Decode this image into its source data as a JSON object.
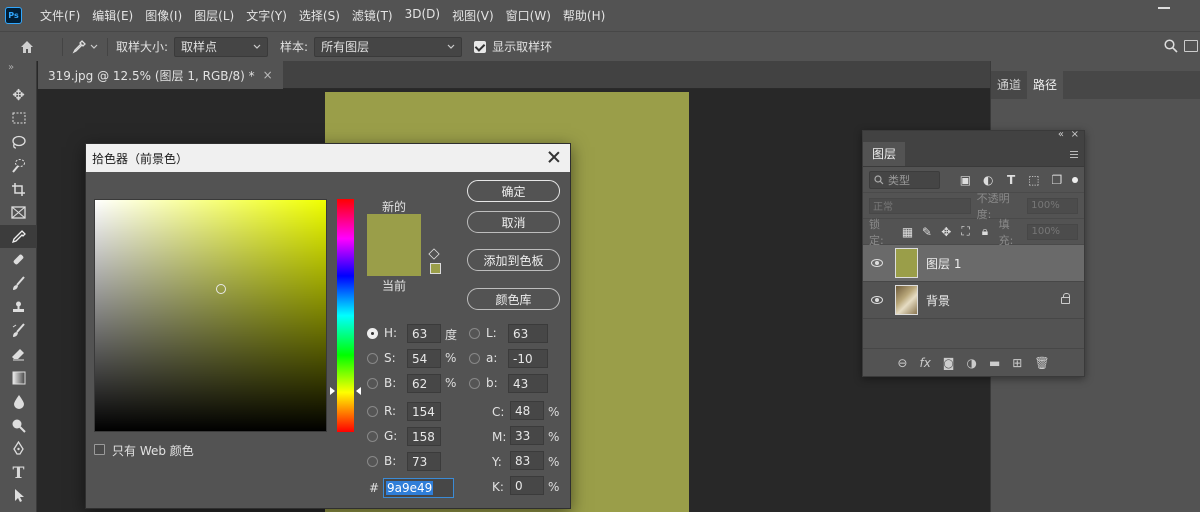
{
  "app": {
    "logo": "Ps"
  },
  "menu": [
    "文件(F)",
    "编辑(E)",
    "图像(I)",
    "图层(L)",
    "文字(Y)",
    "选择(S)",
    "滤镜(T)",
    "3D(D)",
    "视图(V)",
    "窗口(W)",
    "帮助(H)"
  ],
  "options": {
    "sample_size_label": "取样大小:",
    "sample_size_value": "取样点",
    "sample_label": "样本:",
    "sample_value": "所有图层",
    "show_ring_label": "显示取样环"
  },
  "document": {
    "tab_title": "319.jpg @ 12.5% (图层 1, RGB/8) *",
    "tab_close": "×",
    "fill_color": "#9a9e49"
  },
  "dock": {
    "tabs": [
      "通道",
      "路径"
    ]
  },
  "layers_panel": {
    "collapse": "«",
    "close": "×",
    "tab": "图层",
    "filter_placeholder": "类型",
    "blend_mode": "正常",
    "opacity_label": "不透明度:",
    "opacity_value": "100%",
    "lock_label": "锁定:",
    "fill_label": "填充:",
    "fill_value": "100%",
    "layers": [
      {
        "name": "图层 1",
        "thumb_color": "#9a9e49",
        "selected": true
      },
      {
        "name": "背景",
        "thumb_color": "#b9a77a",
        "locked": true
      }
    ],
    "footer_icons": [
      "link-icon",
      "fx-icon",
      "mask-icon",
      "adjustment-icon",
      "folder-icon",
      "new-layer-icon",
      "trash-icon"
    ],
    "fx_label": "fx"
  },
  "color_picker": {
    "title": "拾色器（前景色）",
    "new_label": "新的",
    "current_label": "当前",
    "new_color": "#9a9e49",
    "current_color": "#9a9e49",
    "pure_hue_color": "#f0ff00",
    "buttons": {
      "ok": "确定",
      "cancel": "取消",
      "add_swatch": "添加到色板",
      "libraries": "颜色库"
    },
    "web_only_label": "只有 Web 颜色",
    "hsb": {
      "h_label": "H:",
      "h": "63",
      "h_unit": "度",
      "s_label": "S:",
      "s": "54",
      "s_unit": "%",
      "b_label": "B:",
      "b": "62",
      "b_unit": "%"
    },
    "lab": {
      "l_label": "L:",
      "l": "63",
      "a_label": "a:",
      "a": "-10",
      "b_label": "b:",
      "b": "43"
    },
    "rgb": {
      "r_label": "R:",
      "r": "154",
      "g_label": "G:",
      "g": "158",
      "b_label": "B:",
      "b": "73"
    },
    "cmyk": {
      "c_label": "C:",
      "c": "48",
      "m_label": "M:",
      "m": "33",
      "y_label": "Y:",
      "y": "83",
      "k_label": "K:",
      "k": "0",
      "unit": "%"
    },
    "hex_label": "#",
    "hex": "9a9e49"
  }
}
